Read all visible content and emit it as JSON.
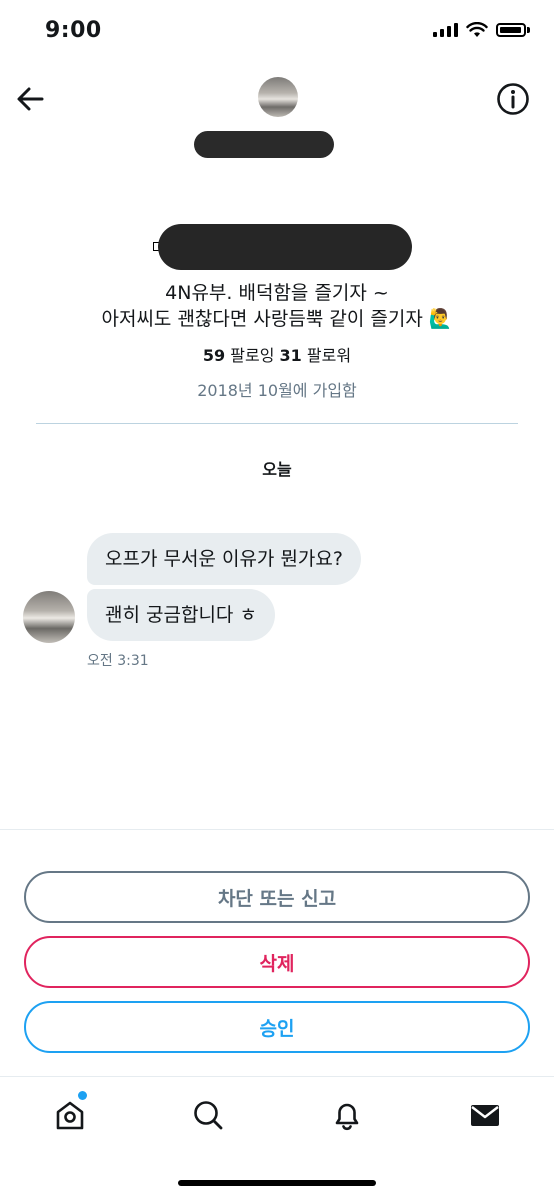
{
  "status_bar": {
    "time": "9:00"
  },
  "header": {
    "back_icon": "arrow-left-icon",
    "info_icon": "info-icon"
  },
  "profile": {
    "bio_line1": "4N유부. 배덕함을 즐기자 ~",
    "bio_line2": "아저씨도 괜찮다면 사랑듬뿍 같이 즐기자 🙋‍♂️",
    "following_count": "59",
    "following_label": "팔로잉",
    "followers_count": "31",
    "followers_label": "팔로워",
    "joined": "2018년 10월에 가입함"
  },
  "conversation": {
    "date_header": "오늘",
    "messages": [
      {
        "text": "오프가 무서운 이유가 뭔가요?"
      },
      {
        "text": "괜히 궁금합니다 ㅎ"
      }
    ],
    "timestamp": "오전 3:31"
  },
  "actions": {
    "block_report_label": "차단 또는 신고",
    "delete_label": "삭제",
    "accept_label": "승인"
  },
  "tab_bar": {
    "items": [
      {
        "icon": "home-icon"
      },
      {
        "icon": "search-icon"
      },
      {
        "icon": "bell-icon"
      },
      {
        "icon": "mail-icon"
      }
    ]
  },
  "colors": {
    "accent_blue": "#1da1f2",
    "danger_red": "#e0245e",
    "muted_gray": "#657786",
    "bubble_bg": "#e8edf0"
  }
}
